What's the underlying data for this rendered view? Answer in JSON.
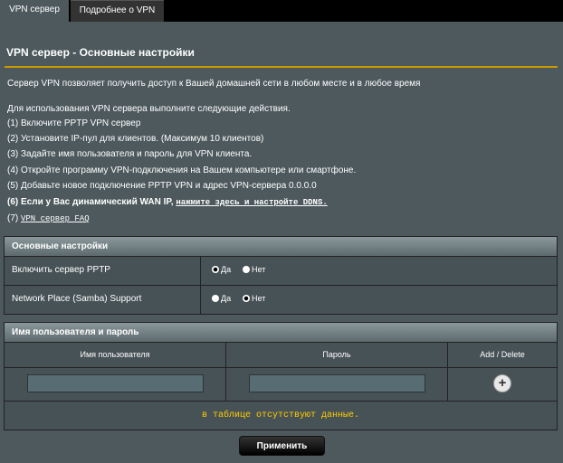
{
  "tabs": [
    {
      "label": "VPN сервер"
    },
    {
      "label": "Подробнее о VPN"
    }
  ],
  "page_title": "VPN сервер - Основные настройки",
  "description": "Сервер VPN позволяет получить доступ к Вашей домашней сети в любом месте и в любое время",
  "instructions": {
    "intro": "Для использования VPN сервера выполните следующие действия.",
    "step1": "(1) Включите PPTP VPN сервер",
    "step2": "(2) Установите IP-пул для клиентов. (Максимум 10 клиентов)",
    "step3": "(3) Задайте имя пользователя и пароль для VPN клиента.",
    "step4": "(4) Откройте программу VPN-подключения на Вашем компьютере или смартфоне.",
    "step5": "(5) Добавьте новое подключение PPTP VPN и адрес VPN-сервера 0.0.0.0",
    "step6_prefix": "(6) Если у Вас динамический WAN IP, ",
    "step6_link": "нажмите здесь и настройте DDNS.",
    "step7_prefix": "(7) ",
    "step7_link": "VPN сервер FAQ"
  },
  "basic_settings": {
    "header": "Основные настройки",
    "rows": [
      {
        "label": "Включить сервер PPTP",
        "options": [
          "Да",
          "Нет"
        ],
        "selected": "Да"
      },
      {
        "label": "Network Place (Samba) Support",
        "options": [
          "Да",
          "Нет"
        ],
        "selected": "Нет"
      }
    ]
  },
  "users": {
    "header": "Имя пользователя и пароль",
    "columns": [
      "Имя пользователя",
      "Пароль",
      "Add / Delete"
    ],
    "username_value": "",
    "password_value": "",
    "add_icon": "plus-circle-icon",
    "empty_message": "в таблице отсутствуют данные."
  },
  "apply_label": "Применить",
  "colors": {
    "background": "#4d595d",
    "accent_line": "#c89a00",
    "empty_text": "#ffcc00"
  }
}
